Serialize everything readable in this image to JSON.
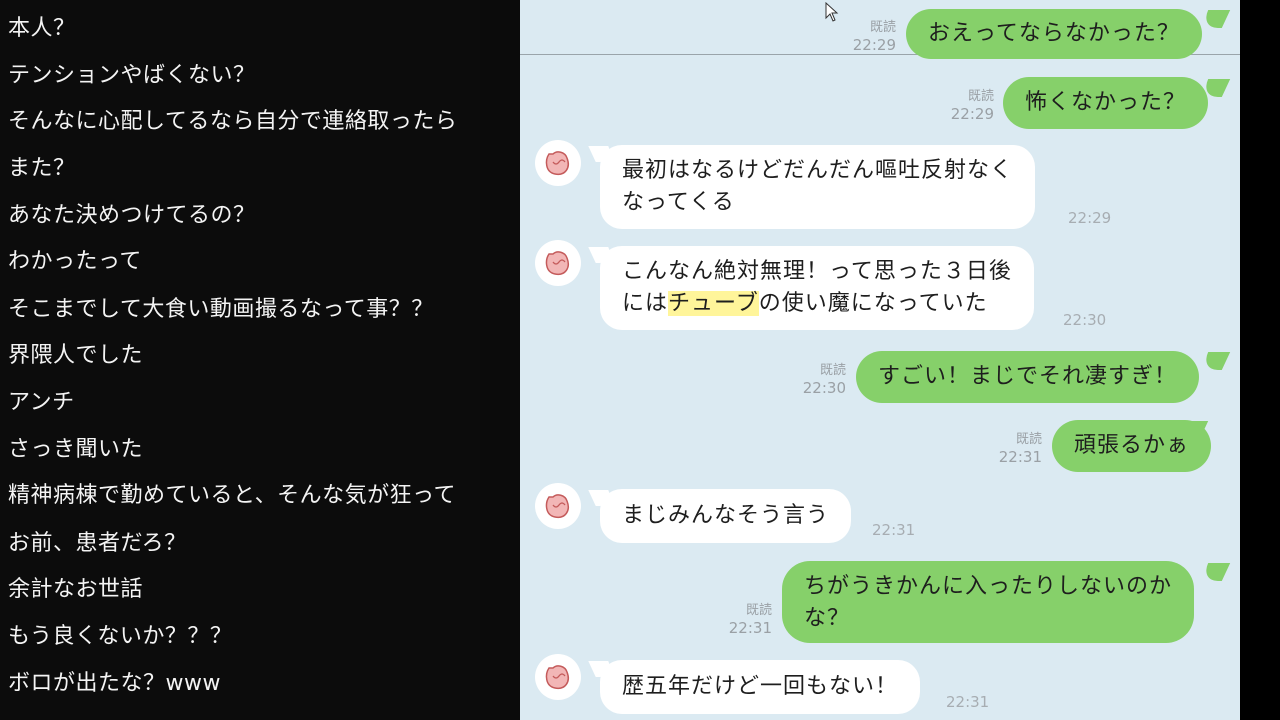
{
  "comments": [
    "本人？",
    "テンションやばくない？",
    "そんなに心配してるなら自分で連絡取ったら",
    "また？",
    "あなた決めつけてるの？",
    "わかったって",
    "そこまでして大食い動画撮るなって事？？",
    "界隈人でした",
    "アンチ",
    "さっき聞いた",
    "精神病棟で勤めていると、そんな気が狂って",
    "お前、患者だろ？",
    "余計なお世話",
    "もう良くないか？？？",
    "ボロが出たな？www"
  ],
  "chat": {
    "read_label": "既読",
    "colors": {
      "outgoing": "#86d06a",
      "incoming": "#ffffff",
      "background": "#dbeaf2",
      "highlight": "#fff59a"
    },
    "messages": [
      {
        "side": "out",
        "lines": [
          "おえってならなかった？"
        ],
        "time": "22:29",
        "read": true
      },
      {
        "side": "out",
        "lines": [
          "怖くなかった？"
        ],
        "time": "22:29",
        "read": true
      },
      {
        "side": "in",
        "lines": [
          "最初はなるけどだんだん嘔吐反射なく",
          "なってくる"
        ],
        "time": "22:29"
      },
      {
        "side": "in",
        "lines": [
          "こんなん絶対無理！って思った３日後",
          "には"
        ],
        "highlight": "チューブ",
        "rest": "の使い魔になっていた",
        "time": "22:30"
      },
      {
        "side": "out",
        "lines": [
          "すごい！まじでそれ凄すぎ！"
        ],
        "time": "22:30",
        "read": true
      },
      {
        "side": "out",
        "lines": [
          "頑張るかぁ"
        ],
        "time": "22:31",
        "read": true
      },
      {
        "side": "in",
        "lines": [
          "まじみんなそう言う"
        ],
        "time": "22:31"
      },
      {
        "side": "out",
        "lines": [
          "ちがうきかんに入ったりしないのか",
          "な？"
        ],
        "time": "22:31",
        "read": true
      },
      {
        "side": "in",
        "lines": [
          "歴五年だけど一回もない！"
        ],
        "time": "22:31"
      }
    ]
  }
}
